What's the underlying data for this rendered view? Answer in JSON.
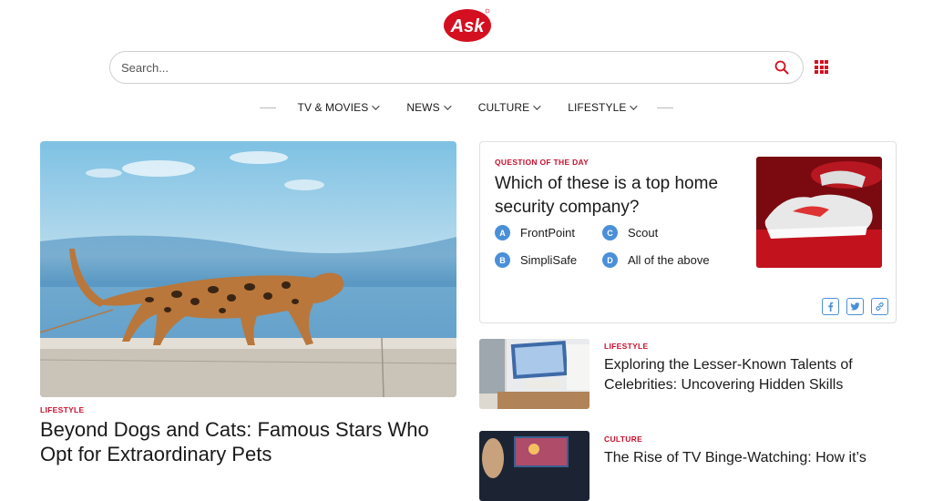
{
  "brand": {
    "logo_text": "Ask",
    "color": "#d40f1f"
  },
  "search": {
    "placeholder": "Search...",
    "icon": "search-icon"
  },
  "apps_icon": "grid-icon",
  "nav": {
    "items": [
      {
        "label": "TV & MOVIES"
      },
      {
        "label": "NEWS"
      },
      {
        "label": "CULTURE"
      },
      {
        "label": "LIFESTYLE"
      }
    ]
  },
  "hero": {
    "category": "LIFESTYLE",
    "title": "Beyond Dogs and Cats: Famous Stars Who Opt for Extraordinary Pets"
  },
  "qotd": {
    "label": "QUESTION OF THE DAY",
    "question": "Which of these is a top home security company?",
    "options": [
      {
        "letter": "A",
        "text": "FrontPoint"
      },
      {
        "letter": "B",
        "text": "SimpliSafe"
      },
      {
        "letter": "C",
        "text": "Scout"
      },
      {
        "letter": "D",
        "text": "All of the above"
      }
    ],
    "share": [
      "facebook-icon",
      "twitter-icon",
      "link-icon"
    ]
  },
  "articles": [
    {
      "category": "LIFESTYLE",
      "title": "Exploring the Lesser-Known Talents of Celebrities: Uncovering Hidden Skills"
    },
    {
      "category": "CULTURE",
      "title": "The Rise of TV Binge-Watching: How it’s"
    }
  ],
  "colors": {
    "accent": "#c8102e",
    "option_badge": "#4a90d9"
  }
}
